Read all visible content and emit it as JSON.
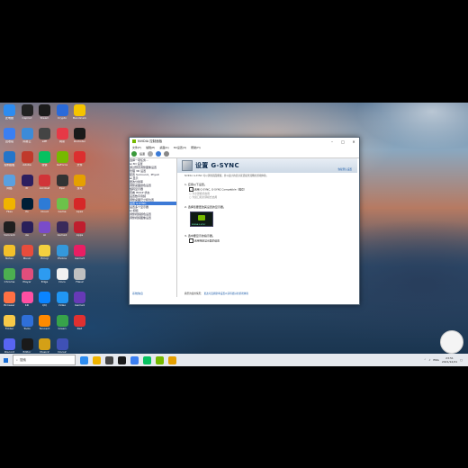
{
  "desktop": {
    "icons": [
      {
        "c": 0,
        "r": 0,
        "color": "#2d8cf0",
        "label": "此电脑"
      },
      {
        "c": 1,
        "r": 0,
        "color": "#222222",
        "label": "CapCut"
      },
      {
        "c": 2,
        "r": 0,
        "color": "#1b1b1b",
        "label": "Steam"
      },
      {
        "c": 3,
        "r": 0,
        "color": "#2a6ad9",
        "label": "Crypto"
      },
      {
        "c": 4,
        "r": 0,
        "color": "#f5c400",
        "label": "Bandicam"
      },
      {
        "c": 0,
        "r": 1,
        "color": "#3b7ff2",
        "label": "回收站"
      },
      {
        "c": 1,
        "r": 1,
        "color": "#3c8bd8",
        "label": "网易云"
      },
      {
        "c": 2,
        "r": 1,
        "color": "#444444",
        "label": "ePE"
      },
      {
        "c": 3,
        "r": 1,
        "color": "#e63946",
        "label": "网易"
      },
      {
        "c": 4,
        "r": 1,
        "color": "#1a1a1a",
        "label": "Rockstar"
      },
      {
        "c": 0,
        "r": 2,
        "color": "#2475c9",
        "label": "控制面板"
      },
      {
        "c": 1,
        "r": 2,
        "color": "#c0392b",
        "label": "Adobe"
      },
      {
        "c": 2,
        "r": 2,
        "color": "#07c160",
        "label": "微信"
      },
      {
        "c": 3,
        "r": 2,
        "color": "#76b900",
        "label": "GeForce"
      },
      {
        "c": 4,
        "r": 2,
        "color": "#dc2f2f",
        "label": "文件"
      },
      {
        "c": 0,
        "r": 3,
        "color": "#5aa0e0",
        "label": "网络"
      },
      {
        "c": 1,
        "r": 3,
        "color": "#2c1e5f",
        "label": "Pr"
      },
      {
        "c": 2,
        "r": 3,
        "color": "#d13438",
        "label": "Acrobat"
      },
      {
        "c": 3,
        "r": 3,
        "color": "#333333",
        "label": "Epic"
      },
      {
        "c": 4,
        "r": 3,
        "color": "#e5a000",
        "label": "游戏"
      },
      {
        "c": 0,
        "r": 4,
        "color": "#f0b400",
        "label": "Files"
      },
      {
        "c": 1,
        "r": 4,
        "color": "#001e36",
        "label": "Ps"
      },
      {
        "c": 2,
        "r": 4,
        "color": "#2e7bd6",
        "label": "Cloud"
      },
      {
        "c": 3,
        "r": 4,
        "color": "#6cc24a",
        "label": "Game"
      },
      {
        "c": 4,
        "r": 4,
        "color": "#d62828",
        "label": "Apex"
      },
      {
        "c": 0,
        "r": 5,
        "color": "#1f1f1f",
        "label": "Valorant"
      },
      {
        "c": 1,
        "r": 5,
        "color": "#2a1f5a",
        "label": "Ae"
      },
      {
        "c": 2,
        "r": 5,
        "color": "#7a4cc9",
        "label": "Ai"
      },
      {
        "c": 3,
        "r": 5,
        "color": "#3a2a5a",
        "label": "Game2"
      },
      {
        "c": 4,
        "r": 5,
        "color": "#bf1e2e",
        "label": "Apps"
      },
      {
        "c": 0,
        "r": 6,
        "color": "#f3c02a",
        "label": "Notes"
      },
      {
        "c": 1,
        "r": 6,
        "color": "#e74c3c",
        "label": "Music"
      },
      {
        "c": 2,
        "r": 6,
        "color": "#f4d03f",
        "label": "Emoji"
      },
      {
        "c": 3,
        "r": 6,
        "color": "#3498db",
        "label": "Photos"
      },
      {
        "c": 4,
        "r": 6,
        "color": "#e91e63",
        "label": "Game3"
      },
      {
        "c": 0,
        "r": 7,
        "color": "#4caf50",
        "label": "Chrome"
      },
      {
        "c": 1,
        "r": 7,
        "color": "#e04e7c",
        "label": "Player"
      },
      {
        "c": 2,
        "r": 7,
        "color": "#2d9bf0",
        "label": "Edge"
      },
      {
        "c": 3,
        "r": 7,
        "color": "#f1f1f1",
        "label": "Docs"
      },
      {
        "c": 4,
        "r": 7,
        "color": "#c0c0c0",
        "label": "Files2"
      },
      {
        "c": 0,
        "r": 8,
        "color": "#ff7043",
        "label": "Browser"
      },
      {
        "c": 1,
        "r": 8,
        "color": "#ff4fa3",
        "label": "bili"
      },
      {
        "c": 2,
        "r": 8,
        "color": "#0a84ff",
        "label": "QQ"
      },
      {
        "c": 3,
        "r": 8,
        "color": "#2196f3",
        "label": "Video"
      },
      {
        "c": 4,
        "r": 8,
        "color": "#673ab7",
        "label": "Game4"
      },
      {
        "c": 0,
        "r": 9,
        "color": "#f7c948",
        "label": "Folder"
      },
      {
        "c": 1,
        "r": 9,
        "color": "#2f6fd8",
        "label": "Tools"
      },
      {
        "c": 2,
        "r": 9,
        "color": "#ff8a00",
        "label": "Tencent"
      },
      {
        "c": 3,
        "r": 9,
        "color": "#37a34a",
        "label": "Green"
      },
      {
        "c": 4,
        "r": 9,
        "color": "#e03030",
        "label": "Red"
      },
      {
        "c": 0,
        "r": 10,
        "color": "#5865f2",
        "label": "Discord"
      },
      {
        "c": 1,
        "r": 10,
        "color": "#1a1a1a",
        "label": "Editor"
      },
      {
        "c": 2,
        "r": 10,
        "color": "#d4a017",
        "label": "Music2"
      },
      {
        "c": 3,
        "r": 10,
        "color": "#3f51b5",
        "label": "Docs2"
      }
    ]
  },
  "window": {
    "title": "NVIDIA 控制面板",
    "menu": [
      "文件(F)",
      "编辑(E)",
      "桌面(K)",
      "3D设置(3)",
      "帮助(H)"
    ],
    "toolbar_back": "后退",
    "sidebar": {
      "header": "选择一项任务...",
      "items": [
        "⊟ 3D 设置",
        "  通过预览调整图像设置",
        "  管理 3D 设置",
        "  配置 Surround、PhysX",
        "⊟ 显示",
        "  更改分辨率",
        "  调整桌面颜色设置",
        "  旋转显示器",
        "  查看 HDCP 状态",
        "  设置数字音频",
        "  调整桌面尺寸和位置",
        "  设置 G-SYNC",
        "  设置多个显示器",
        "⊟ 视频",
        "  调整视频颜色设置",
        "  调整视频图像设置"
      ],
      "selected_index": 11,
      "system_info": "系统信息"
    },
    "content": {
      "title": "设置 G-SYNC",
      "restore_link": "恢复默认设置",
      "description": "NVIDIA G-SYNC 可以消除画面撕裂，并以最小的显示延迟提供流畅的游戏体验。",
      "section1": "1. 应用以下设置。",
      "opt_enable": "启用 G-SYNC, G-SYNC Compatible（推荐）",
      "opt_window": "为全屏模式启用",
      "opt_window2": "为窗口和全屏模式启用",
      "section2": "2. 选择您要更改其设置的显示器。",
      "monitor_caption": "NVIDIA G-SYNC",
      "section3": "3. 选中要显示的指示器。",
      "opt_indicator": "启用特定显示器的设置",
      "footer_text": "典型的使用情形：",
      "footer_link": "更改可变刷新率设置以获得更好的游戏体验"
    }
  },
  "taskbar": {
    "search_placeholder": "搜索",
    "apps": [
      "#2d8cf0",
      "#f0b400",
      "#444444",
      "#1a1a1a",
      "#3b7ff2",
      "#07c160",
      "#76b900",
      "#e5a000"
    ],
    "tray_lang": "ENG",
    "time": "23:51",
    "date": "2021/12/21"
  }
}
